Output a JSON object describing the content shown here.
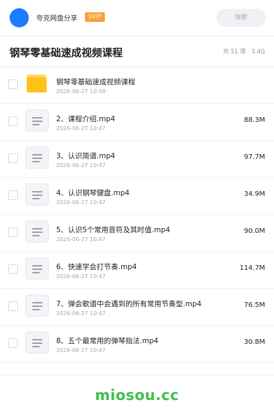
{
  "header": {
    "app_name": "夸克网盘分享",
    "badge": "SVIP",
    "search_placeholder": "搜索"
  },
  "folder": {
    "title": "钢琴零基础速成视频课程",
    "meta": "共 51 项 · 3.4G"
  },
  "files": [
    {
      "name": "钢琴零基础速成视频课程",
      "date": "2026-06-27 10:48",
      "size": "",
      "type": "folder"
    },
    {
      "name": "2、课程介绍.mp4",
      "date": "2026-06-27 10:47",
      "size": "88.3M",
      "type": "video"
    },
    {
      "name": "3、认识简谱.mp4",
      "date": "2026-06-27 10:47",
      "size": "97.7M",
      "type": "video"
    },
    {
      "name": "4、认识钢琴键盘.mp4",
      "date": "2026-06-27 10:47",
      "size": "34.9M",
      "type": "video"
    },
    {
      "name": "5、认识5个常用音符及其时值.mp4",
      "date": "2026-06-27 10:47",
      "size": "90.0M",
      "type": "video"
    },
    {
      "name": "6、快速学会打节奏.mp4",
      "date": "2026-06-27 10:47",
      "size": "114.7M",
      "type": "video"
    },
    {
      "name": "7、弹会歌谱中会遇到的所有常用节奏型.mp4",
      "date": "2026-06-27 10:47",
      "size": "76.5M",
      "type": "video"
    },
    {
      "name": "8、五个最常用的弹琴指法.mp4",
      "date": "2026-06-27 10:47",
      "size": "30.8M",
      "type": "video"
    }
  ],
  "watermark": "miosou.cc",
  "colors": {
    "accent": "#1f7bff",
    "svip": "#f7a234",
    "folder": "#ffc21b",
    "watermark": "#3bc14a"
  },
  "icons": {
    "avatar": "avatar",
    "folder": "folder-icon",
    "video": "document-lines-icon"
  }
}
